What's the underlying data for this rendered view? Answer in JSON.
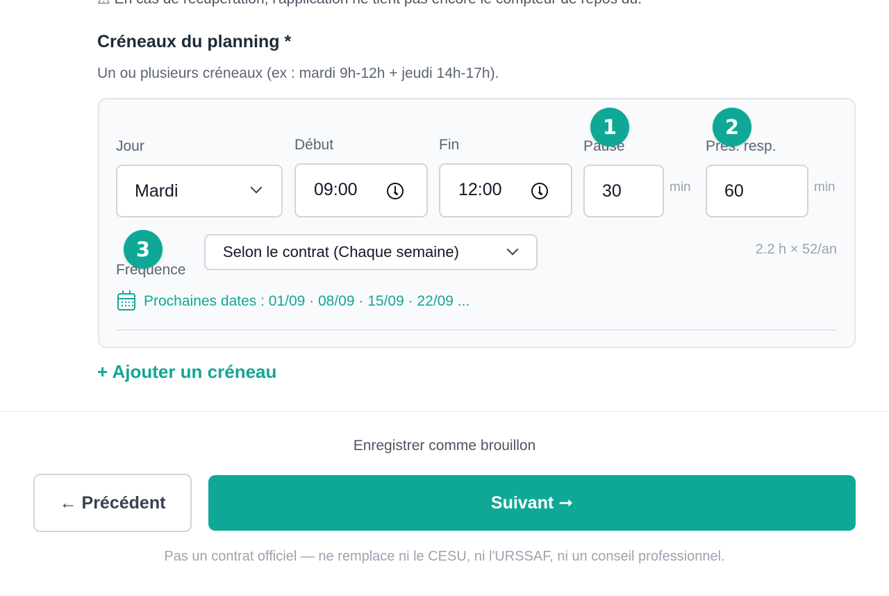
{
  "top_note": "⚠ En cas de récupération, l'application ne tient pas encore le compteur de repos dû.",
  "section": {
    "title": "Créneaux du planning *",
    "help": "Un ou plusieurs créneaux (ex : mardi 9h-12h + jeudi 14h-17h)."
  },
  "slot": {
    "day_label": "Jour",
    "day_value": "Mardi",
    "start_label": "Début",
    "start_value": "09:00",
    "end_label": "Fin",
    "end_value": "12:00",
    "pause_label": "Pause",
    "pause_value": "30",
    "pause_unit": "min",
    "resp_label": "Prés. resp.",
    "resp_value": "60",
    "resp_unit": "min",
    "freq_label": "Fréquence",
    "freq_value": "Selon le contrat (Chaque semaine)",
    "freq_summary": "2.2 h × 52/an",
    "next_dates": "Prochaines dates : 01/09 · 08/09 · 15/09 · 22/09 ..."
  },
  "badges": [
    "1",
    "2",
    "3"
  ],
  "add_slot_label": "+ Ajouter un créneau",
  "draft_label": "Enregistrer comme brouillon",
  "prev_label": "← Précédent",
  "next_label": "Suivant ➞",
  "disclaimer": "Pas un contrat officiel — ne remplace ni le CESU, ni l'URSSAF, ni un conseil professionnel.",
  "colors": {
    "accent": "#0fa897",
    "badge": "#0fa897",
    "link": "#14a596"
  },
  "icons": [
    "chevron-down-icon",
    "clock-icon",
    "calendar-icon"
  ]
}
